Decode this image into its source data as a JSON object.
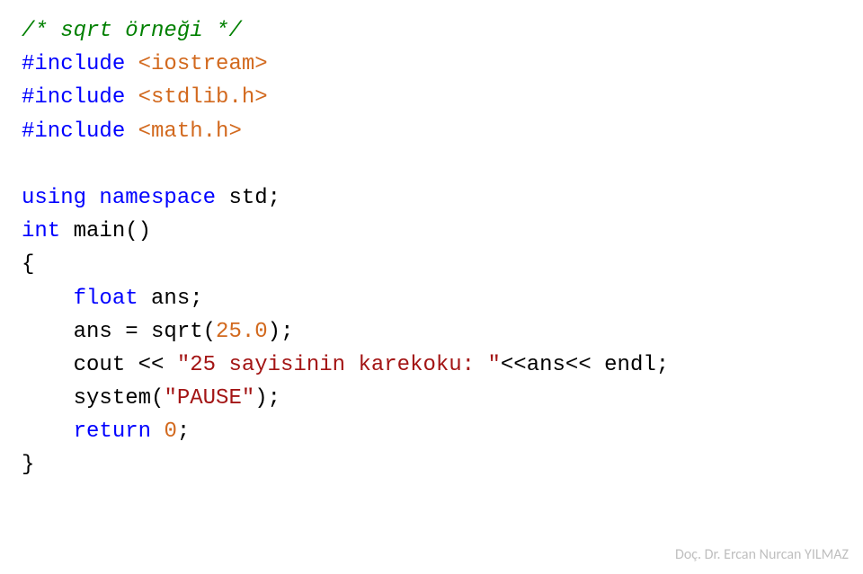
{
  "code": {
    "comment": "/* sqrt örneği */",
    "include1_kw": "#include ",
    "include1_val": "<iostream>",
    "include2_kw": "#include ",
    "include2_val": "<stdlib.h>",
    "include3_kw": "#include ",
    "include3_val": "<math.h>",
    "using_kw": "using ",
    "namespace_kw": "namespace ",
    "std": "std",
    "semi": ";",
    "int_kw": "int ",
    "main": "main",
    "paren": "()",
    "brace_open": "{",
    "indent": "    ",
    "float_kw": "float ",
    "ans": "ans",
    "ans_assign": "ans = ",
    "sqrt": "sqrt",
    "sqrt_arg_open": "(",
    "sqrt_num": "25.0",
    "sqrt_arg_close": ")",
    "cout": "cout",
    "lshift": " << ",
    "string": "\"25 sayisinin karekoku: \"",
    "lshift2": "<<",
    "ans2": "ans",
    "lshift3": "<< ",
    "endl": "endl",
    "system": "system",
    "paren_open": "(",
    "pause_str": "\"PAUSE\"",
    "paren_close": ")",
    "return_kw": "return ",
    "zero": "0",
    "brace_close": "}"
  },
  "footer": "Doç. Dr. Ercan Nurcan YILMAZ"
}
